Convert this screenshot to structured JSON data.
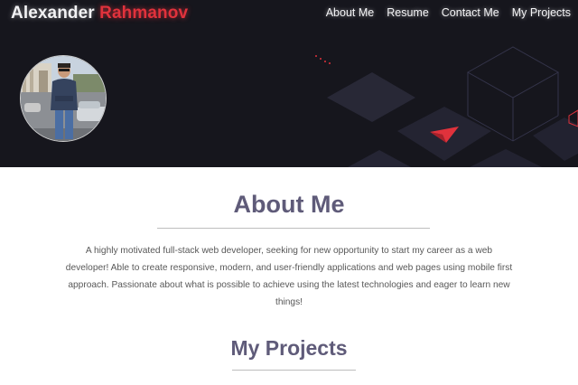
{
  "header": {
    "brand_first": "Alexander",
    "brand_last": "Rahmanov",
    "nav": [
      {
        "label": "About Me"
      },
      {
        "label": "Resume"
      },
      {
        "label": "Contact Me"
      },
      {
        "label": "My Projects"
      }
    ]
  },
  "about": {
    "title": "About Me",
    "text": "A highly motivated full-stack web developer, seeking for new opportunity to start my career as a web developer! Able to create responsive, modern, and user-friendly applications and web pages using mobile first approach. Passionate about what is possible to achieve using the latest technologies and eager to learn new things!"
  },
  "projects": {
    "title": "My Projects"
  },
  "colors": {
    "hero_bg": "#16161d",
    "accent": "#e0323c",
    "heading": "#5f5b79"
  }
}
